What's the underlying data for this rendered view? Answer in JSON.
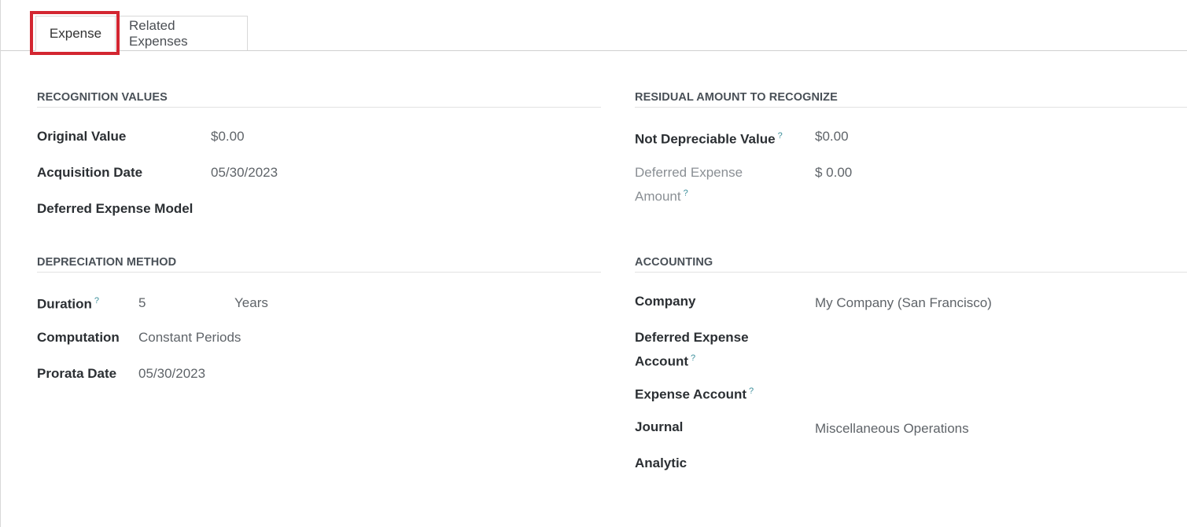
{
  "tabs": [
    {
      "label": "Expense",
      "active": true
    },
    {
      "label": "Related Expenses",
      "active": false
    }
  ],
  "highlight_color": "#d32631",
  "recognition_values": {
    "title": "RECOGNITION VALUES",
    "original_value_label": "Original Value",
    "original_value": "$0.00",
    "acquisition_date_label": "Acquisition Date",
    "acquisition_date": "05/30/2023",
    "model_label": "Deferred Expense Model",
    "model_value": ""
  },
  "residual": {
    "title": "RESIDUAL AMOUNT TO RECOGNIZE",
    "not_depreciable_label": "Not Depreciable Value",
    "not_depreciable_value": "$0.00",
    "deferred_amount_label_line1": "Deferred Expense",
    "deferred_amount_label_line2": "Amount",
    "deferred_amount_value": "$ 0.00",
    "help_mark": "?"
  },
  "depreciation": {
    "title": "DEPRECIATION METHOD",
    "duration_label": "Duration",
    "duration_value": "5",
    "duration_unit": "Years",
    "computation_label": "Computation",
    "computation_value": "Constant Periods",
    "prorata_label": "Prorata Date",
    "prorata_value": "05/30/2023"
  },
  "accounting": {
    "title": "ACCOUNTING",
    "company_label": "Company",
    "company_value": "My Company (San Francisco)",
    "deferred_account_label_line1": "Deferred Expense",
    "deferred_account_label_line2": "Account",
    "expense_account_label": "Expense Account",
    "journal_label": "Journal",
    "journal_value": "Miscellaneous Operations",
    "analytic_label": "Analytic"
  }
}
